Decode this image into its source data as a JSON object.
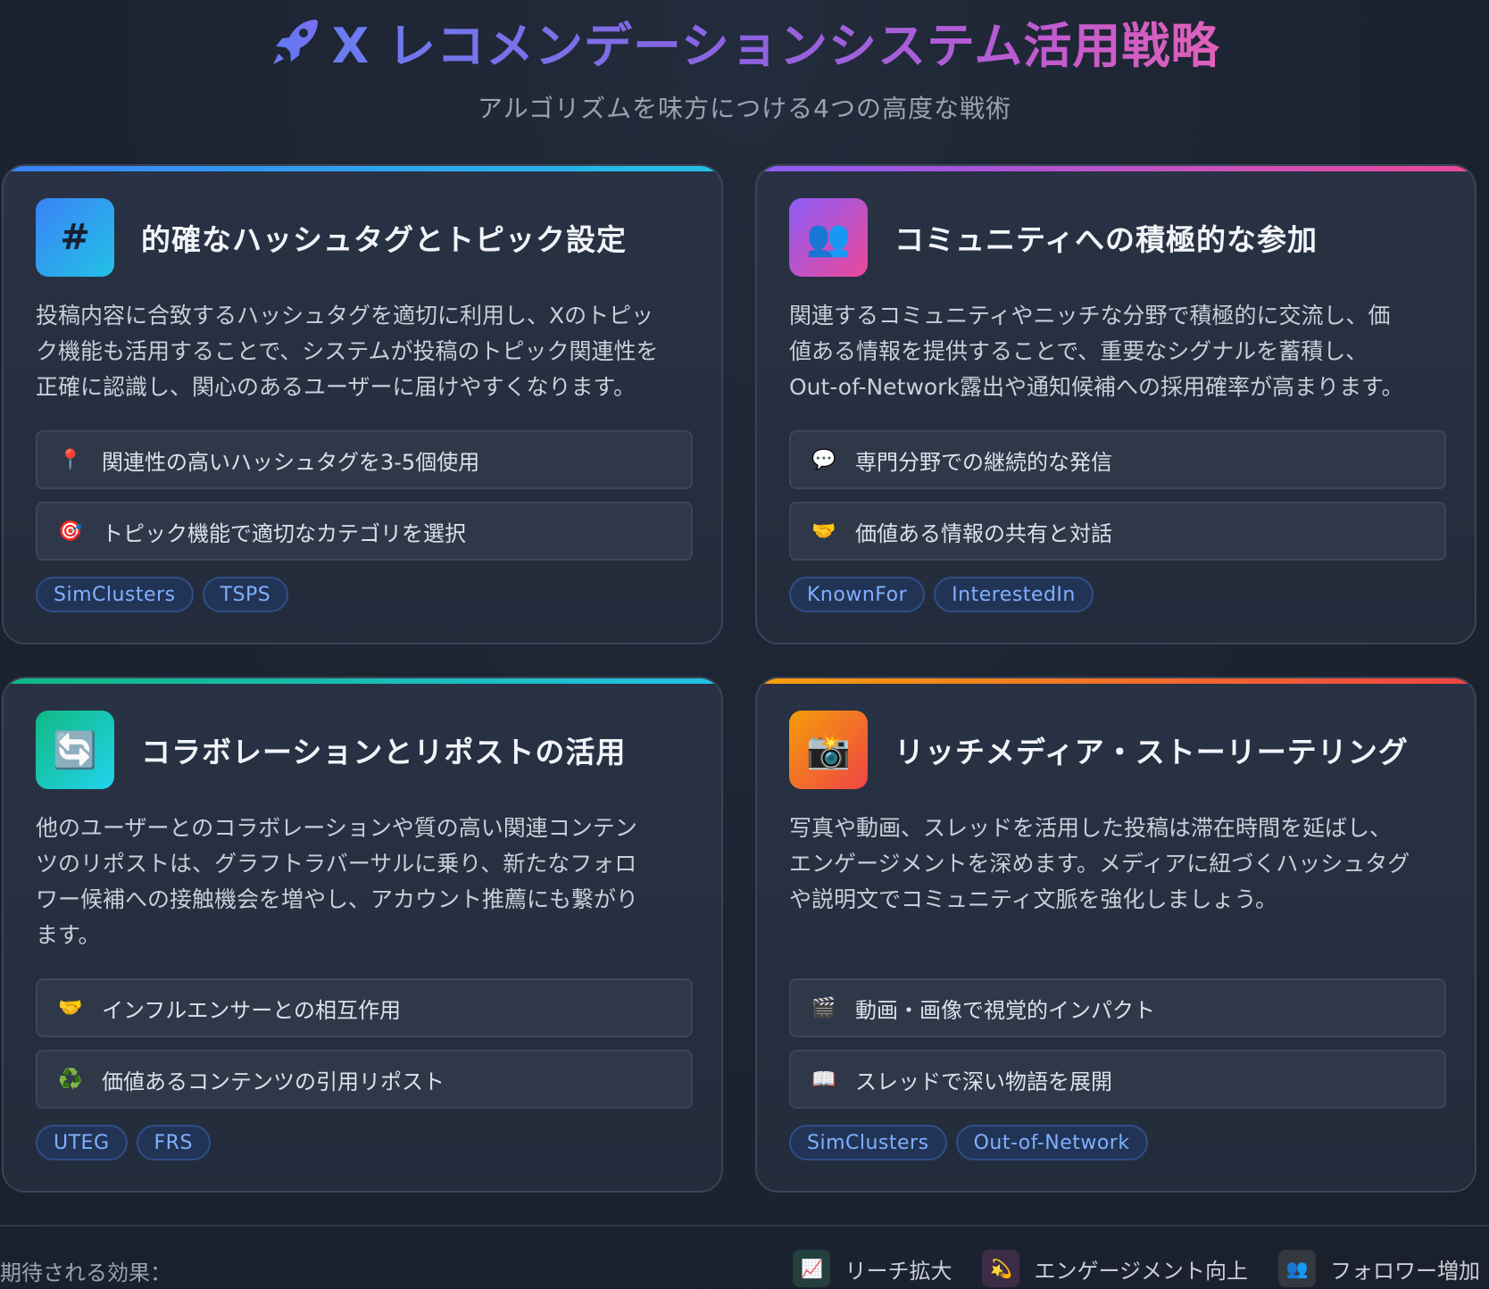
{
  "header": {
    "title": "X レコメンデーションシステム活用戦略",
    "subtitle": "アルゴリズムを味方につける4つの高度な戦術"
  },
  "cards": [
    {
      "icon": "hash",
      "title": "的確なハッシュタグとトピック設定",
      "desc": [
        "投稿内容に合致するハッシュタグを適切に利用し、Xのトピッ",
        "ク機能も活用することで、システムが投稿のトピック関連性を",
        "正確に認識し、関心のあるユーザーに届けやすくなります。"
      ],
      "items": [
        {
          "icon": "📍",
          "label": "関連性の高いハッシュタグを3-5個使用"
        },
        {
          "icon": "🎯",
          "label": "トピック機能で適切なカテゴリを選択"
        }
      ],
      "tags": [
        "SimClusters",
        "TSPS"
      ]
    },
    {
      "icon": "👥",
      "title": "コミュニティへの積極的な参加",
      "desc": [
        "関連するコミュニティやニッチな分野で積極的に交流し、価",
        "値ある情報を提供することで、重要なシグナルを蓄積し、",
        "Out-of-Network露出や通知候補への採用確率が高まります。"
      ],
      "items": [
        {
          "icon": "💬",
          "label": "専門分野での継続的な発信"
        },
        {
          "icon": "🤝",
          "label": "価値ある情報の共有と対話"
        }
      ],
      "tags": [
        "KnownFor",
        "InterestedIn"
      ]
    },
    {
      "icon": "🔄",
      "title": "コラボレーションとリポストの活用",
      "desc": [
        "他のユーザーとのコラボレーションや質の高い関連コンテン",
        "ツのリポストは、グラフトラバーサルに乗り、新たなフォロ",
        "ワー候補への接触機会を増やし、アカウント推薦にも繋がり",
        "ます。"
      ],
      "items": [
        {
          "icon": "🤝",
          "label": "インフルエンサーとの相互作用"
        },
        {
          "icon": "♻️",
          "label": "価値あるコンテンツの引用リポスト"
        }
      ],
      "tags": [
        "UTEG",
        "FRS"
      ]
    },
    {
      "icon": "📸",
      "title": "リッチメディア・ストーリーテリング",
      "desc": [
        "写真や動画、スレッドを活用した投稿は滞在時間を延ばし、",
        "エンゲージメントを深めます。メディアに紐づくハッシュタグ",
        "や説明文でコミュニティ文脈を強化しましょう。"
      ],
      "items": [
        {
          "icon": "🎬",
          "label": "動画・画像で視覚的インパクト"
        },
        {
          "icon": "📖",
          "label": "スレッドで深い物語を展開"
        }
      ],
      "tags": [
        "SimClusters",
        "Out-of-Network"
      ]
    }
  ],
  "footer": {
    "label": "期待される効果：",
    "effects": [
      {
        "icon": "📈",
        "label": "リーチ拡大"
      },
      {
        "icon": "💫",
        "label": "エンゲージメント向上"
      },
      {
        "icon": "👥",
        "label": "フォロワー増加"
      }
    ]
  },
  "colors": {
    "background": "#1d2533",
    "card": "#273042",
    "tag_text": "#7fb0ff",
    "title_gradient_start": "#6a7cf0",
    "title_gradient_end": "#e060b8"
  }
}
